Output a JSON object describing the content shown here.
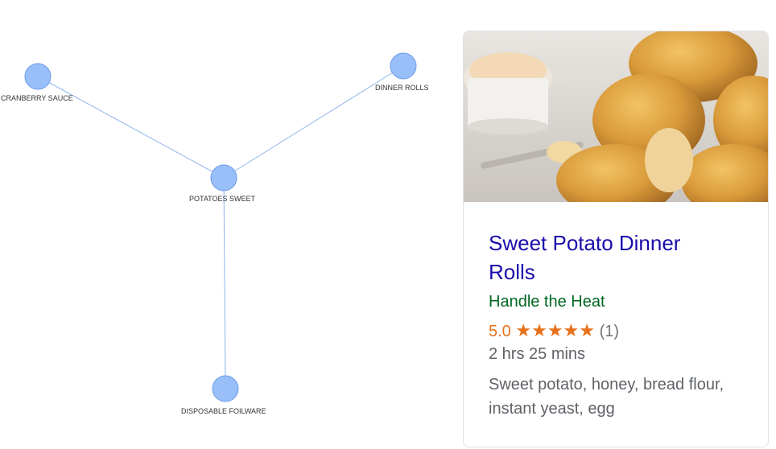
{
  "graph": {
    "nodes": [
      {
        "id": "cranberry",
        "label": "CRANBERRY SAUCE"
      },
      {
        "id": "dinner",
        "label": "DINNER ROLLS"
      },
      {
        "id": "potatoes",
        "label": "POTATOES SWEET"
      },
      {
        "id": "foilware",
        "label": "DISPOSABLE FOILWARE"
      }
    ],
    "edges": [
      [
        "potatoes",
        "cranberry"
      ],
      [
        "potatoes",
        "dinner"
      ],
      [
        "potatoes",
        "foilware"
      ]
    ],
    "colors": {
      "node_fill": "#99bff9",
      "node_stroke": "#6a9ae6",
      "edge": "#8fb5ec"
    }
  },
  "recipe_card": {
    "title": "Sweet Potato Dinner Rolls",
    "source": "Handle the Heat",
    "rating": "5.0",
    "stars": "★★★★★",
    "review_count": "(1)",
    "time": "2 hrs 25 mins",
    "ingredients": "Sweet potato, honey, bread flour, instant yeast, egg",
    "colors": {
      "title": "#1a0dab",
      "source": "#006621",
      "rating": "#e7711b"
    }
  }
}
